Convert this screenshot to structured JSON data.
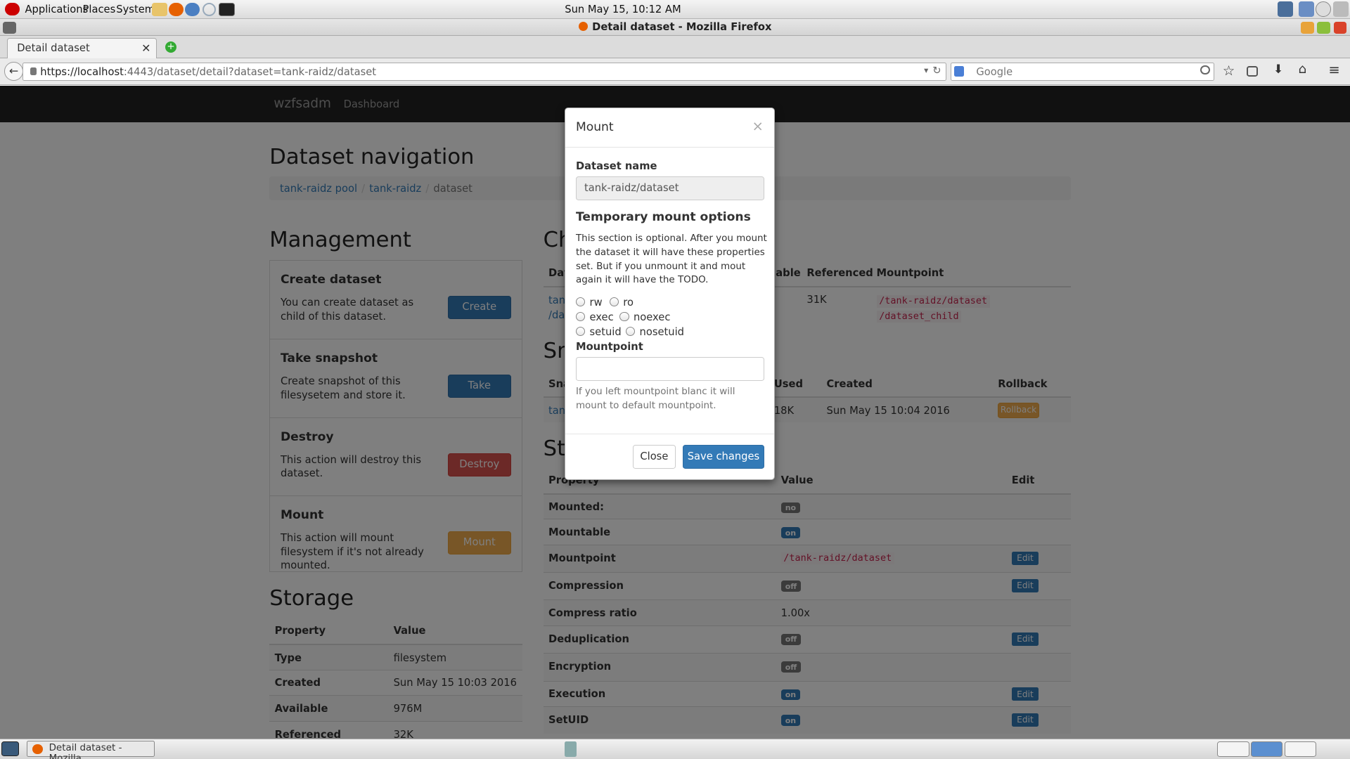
{
  "panel": {
    "applications": "Applications",
    "places": "Places",
    "system": "System",
    "clock": "Sun May 15, 10:12 AM"
  },
  "window": {
    "title": "Detail dataset - Mozilla Firefox"
  },
  "browser": {
    "tab_title": "Detail dataset",
    "url_host": "https://localhost",
    "url_rest": ":4443/dataset/detail?dataset=tank-raidz/dataset",
    "search_placeholder": "Google"
  },
  "app": {
    "brand": "wzfsadm",
    "nav_dashboard": "Dashboard"
  },
  "headings": {
    "dataset_navigation": "Dataset navigation",
    "management": "Management",
    "storage": "Storage",
    "children_partial": "Ch",
    "snapshots_partial": "Sn",
    "storage2_partial": "St"
  },
  "breadcrumb": [
    "tank-raidz pool",
    "tank-raidz",
    "dataset"
  ],
  "management": [
    {
      "title": "Create dataset",
      "text": "You can create dataset as child of this dataset.",
      "button": "Create"
    },
    {
      "title": "Take snapshot",
      "text": "Create snapshot of this filesysetem and store it.",
      "button": "Take"
    },
    {
      "title": "Destroy",
      "text": "This action will destroy this dataset.",
      "button": "Destroy"
    },
    {
      "title": "Mount",
      "text": "This action will mount filesystem if it's not already mounted.",
      "button": "Mount"
    }
  ],
  "storage": {
    "headers": [
      "Property",
      "Value"
    ],
    "rows": [
      [
        "Type",
        "filesystem"
      ],
      [
        "Created",
        "Sun May 15 10:03 2016"
      ],
      [
        "Available",
        "976M"
      ],
      [
        "Referenced",
        "32K"
      ]
    ]
  },
  "children": {
    "headers": [
      "Dat",
      "able",
      "Referenced",
      "Mountpoint"
    ],
    "row": {
      "name1": "tan",
      "name2": "/dat",
      "referenced": "31K",
      "mount1": "/tank-raidz/dataset",
      "mount2": "/dataset_child"
    }
  },
  "snapshots": {
    "headers": [
      "Sna",
      "Used",
      "Created",
      "Rollback"
    ],
    "row": {
      "name": "tan",
      "used": "18K",
      "created": "Sun May 15 10:04 2016",
      "button": "Rollback"
    }
  },
  "properties": {
    "headers": [
      "Property",
      "Value",
      "Edit"
    ],
    "edit_label": "Edit",
    "rows": [
      {
        "name": "Mounted:",
        "value": "no",
        "kind": "gray",
        "edit": false
      },
      {
        "name": "Mountable",
        "value": "on",
        "kind": "blue",
        "edit": false
      },
      {
        "name": "Mountpoint",
        "value": "/tank-raidz/dataset",
        "kind": "code",
        "edit": true
      },
      {
        "name": "Compression",
        "value": "off",
        "kind": "gray",
        "edit": true
      },
      {
        "name": "Compress ratio",
        "value": "1.00x",
        "kind": "text",
        "edit": false
      },
      {
        "name": "Deduplication",
        "value": "off",
        "kind": "gray",
        "edit": true
      },
      {
        "name": "Encryption",
        "value": "off",
        "kind": "gray",
        "edit": false
      },
      {
        "name": "Execution",
        "value": "on",
        "kind": "blue",
        "edit": true
      },
      {
        "name": "SetUID",
        "value": "on",
        "kind": "blue",
        "edit": true
      }
    ]
  },
  "modal": {
    "title": "Mount",
    "close": "×",
    "dataset_label": "Dataset name",
    "dataset_value": "tank-raidz/dataset",
    "options_heading": "Temporary mount options",
    "options_text": "This section is optional. After you mount the dataset it will have these properties set. But if you unmount it and mout again it will have the TODO.",
    "radios": [
      [
        "rw",
        "ro"
      ],
      [
        "exec",
        "noexec"
      ],
      [
        "setuid",
        "nosetuid"
      ]
    ],
    "mountpoint_label": "Mountpoint",
    "mountpoint_value": "",
    "mountpoint_help": "If you left mountpoint blanc it will mount to default mountpoint.",
    "close_button": "Close",
    "save_button": "Save changes"
  },
  "taskbar": {
    "window_button": "Detail dataset - Mozilla..."
  }
}
